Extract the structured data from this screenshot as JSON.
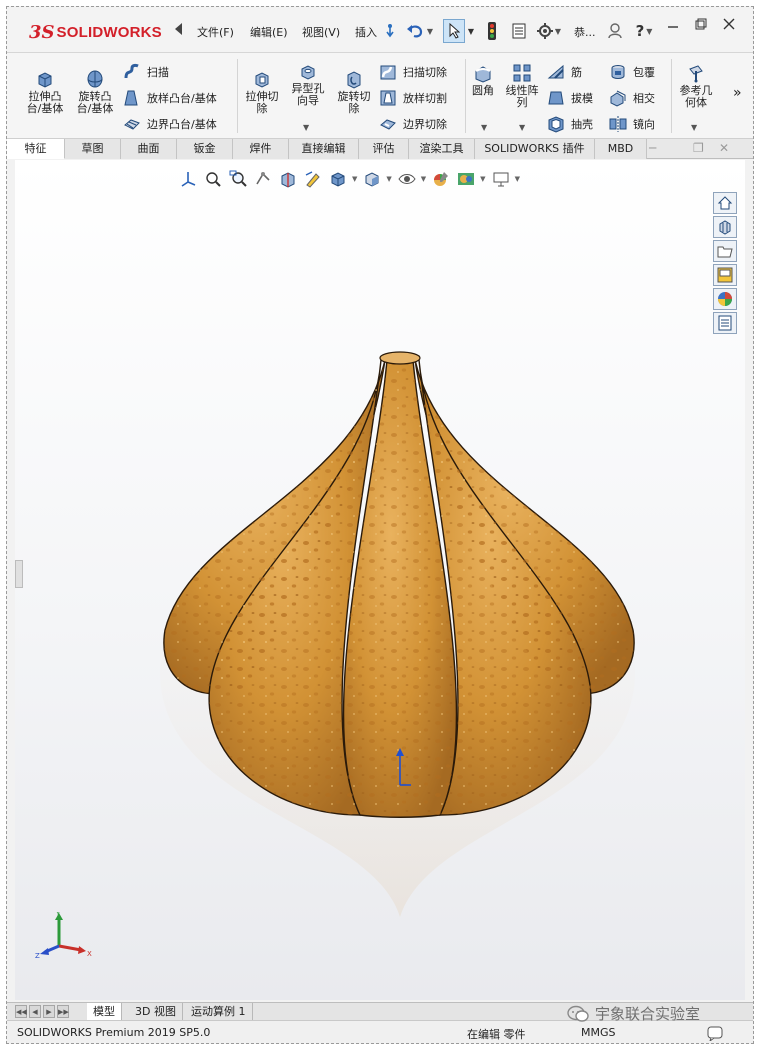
{
  "app": {
    "logo_ds": "3S",
    "logo_text": "SOLIDWORKS"
  },
  "menu": {
    "file": "文件(F)",
    "edit": "编辑(E)",
    "view": "视图(V)",
    "insert": "插入",
    "user": "恭..."
  },
  "ribbon": {
    "extrude_boss": "拉伸凸\n台/基体",
    "revolve_boss": "旋转凸\n台/基体",
    "sweep": "扫描",
    "loft": "放样凸台/基体",
    "boundary_boss": "边界凸台/基体",
    "extrude_cut": "拉伸切\n除",
    "hole_wizard": "异型孔\n向导",
    "revolve_cut": "旋转切\n除",
    "swept_cut": "扫描切除",
    "lofted_cut": "放样切割",
    "boundary_cut": "边界切除",
    "fillet": "圆角",
    "linear_pattern": "线性阵\n列",
    "rib": "筋",
    "draft": "拔模",
    "shell": "抽壳",
    "wrap": "包覆",
    "intersect": "相交",
    "mirror": "镜向",
    "ref_geometry": "参考几\n何体",
    "more": "»"
  },
  "tabs": [
    "特征",
    "草图",
    "曲面",
    "钣金",
    "焊件",
    "直接编辑",
    "评估",
    "渲染工具",
    "SOLIDWORKS 插件",
    "MBD"
  ],
  "active_tab": "特征",
  "bottom_tabs": [
    "模型",
    "3D 视图",
    "运动算例 1"
  ],
  "active_bottom_tab": "模型",
  "status": {
    "product": "SOLIDWORKS Premium 2019 SP5.0",
    "editing": "在编辑 零件",
    "units": "MMGS"
  },
  "triad": {
    "x": "X",
    "y": "Y",
    "z": "Z"
  },
  "watermark": "宇象联合实验室",
  "colors": {
    "brand_red": "#d3202a",
    "model_base": "#d59a3c",
    "accent_blue": "#1f4fd1"
  }
}
